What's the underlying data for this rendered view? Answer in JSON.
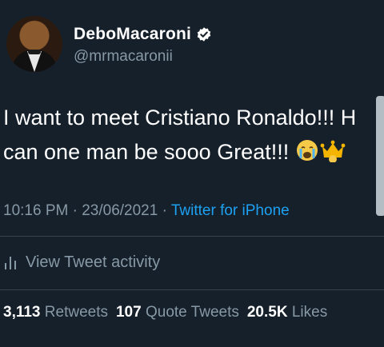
{
  "user": {
    "display_name": "DeboMacaroni",
    "handle": "@mrmacaronii"
  },
  "tweet": {
    "line1": "I want to meet Cristiano Ronaldo!!! H",
    "line2": "can one man be sooo Great!!! ",
    "emojis": [
      "crying-face",
      "crown"
    ]
  },
  "meta": {
    "time": "10:16 PM",
    "sep1": " · ",
    "date": "23/06/2021",
    "sep2": " · ",
    "source": "Twitter for iPhone"
  },
  "activity": {
    "label": "View Tweet activity"
  },
  "stats": {
    "retweets_count": "3,113",
    "retweets_label": "Retweets",
    "quotes_count": "107",
    "quotes_label": "Quote Tweets",
    "likes_count": "20.5K",
    "likes_label": "Likes"
  },
  "colors": {
    "background": "#15202b",
    "muted": "#8899a6",
    "link": "#1da1f2"
  }
}
